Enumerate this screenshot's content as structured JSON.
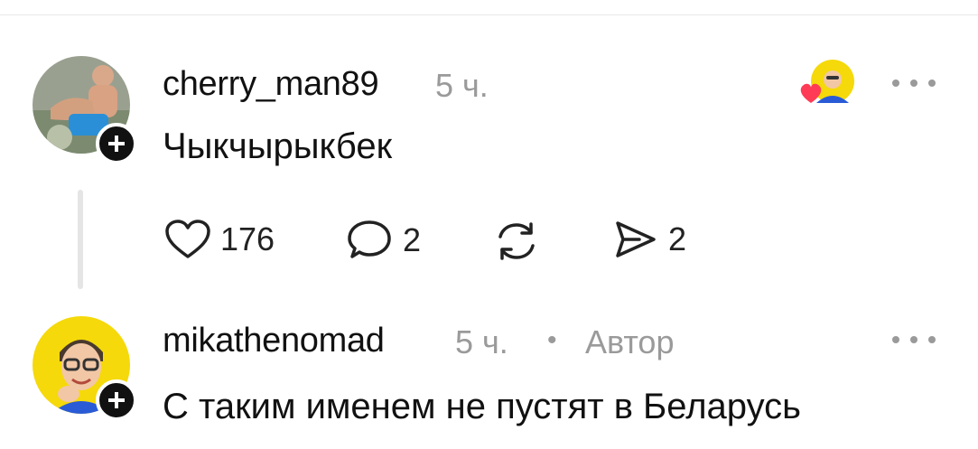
{
  "comments": [
    {
      "username": "cherry_man89",
      "time": "5 ч.",
      "text": "Чыкчырыкбек",
      "actions": {
        "likes": "176",
        "replies": "2",
        "shares": "2"
      }
    },
    {
      "username": "mikathenomad",
      "time": "5 ч.",
      "separator": "•",
      "badge": "Автор",
      "text": "С таким именем не пустят в Беларусь"
    }
  ],
  "colors": {
    "accent_heart": "#ff3b55",
    "muted": "#9a9a9a",
    "avatar_yellow": "#f5d90a"
  },
  "icons": [
    "heart-icon",
    "comment-icon",
    "repost-icon",
    "send-icon",
    "plus-icon",
    "more-icon"
  ]
}
